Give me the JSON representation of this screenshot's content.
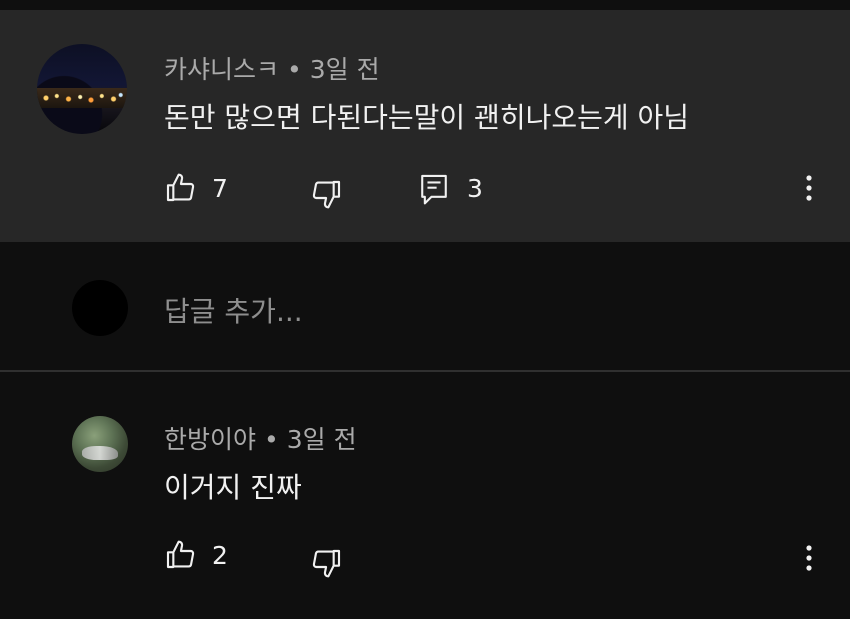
{
  "comments": [
    {
      "author": "카샤니스ㅋ",
      "separator": "•",
      "time": "3일 전",
      "text": "돈만 많으면 다된다는말이 괜히나오는게 아님",
      "likes": "7",
      "replies": "3"
    },
    {
      "author": "한방이야",
      "separator": "•",
      "time": "3일 전",
      "text": "이거지 진짜",
      "likes": "2"
    }
  ],
  "reply_box": {
    "placeholder": "답글 추가..."
  },
  "icons": {
    "like": "thumbs-up-icon",
    "dislike": "thumbs-down-icon",
    "reply": "comment-icon",
    "more": "more-vert-icon"
  },
  "colors": {
    "background": "#0f0f0f",
    "highlight": "#272727",
    "secondary_text": "#aaaaaa",
    "primary_text": "#f1f1f1"
  }
}
